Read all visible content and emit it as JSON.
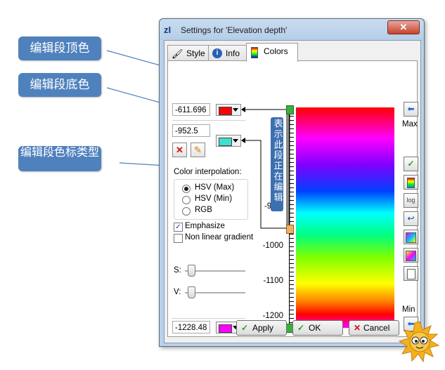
{
  "callouts": {
    "top_color": "编辑段顶色",
    "bottom_color": "编辑段底色",
    "color_type": "编辑段色标类型",
    "editing_note": "表示此段正在编辑"
  },
  "window": {
    "icon": "zI",
    "title": "Settings for 'Elevation depth'",
    "close_glyph": "✕"
  },
  "tabs": [
    {
      "label": "Style",
      "icon": "brush-icon"
    },
    {
      "label": "Info",
      "icon": "info-icon"
    },
    {
      "label": "Colors",
      "icon": "colors-icon",
      "active": true
    }
  ],
  "segment": {
    "top_value": "-611.696",
    "top_color": "#ff0000",
    "bottom_value": "-952.5",
    "bottom_color": "#40e0d0"
  },
  "interpolation": {
    "label": "Color interpolation:",
    "options": [
      {
        "label": "HSV (Max)",
        "selected": true
      },
      {
        "label": "HSV (Min)",
        "selected": false
      },
      {
        "label": "RGB",
        "selected": false
      }
    ]
  },
  "checkboxes": [
    {
      "label": "Emphasize",
      "checked": true
    },
    {
      "label": "Non linear gradient",
      "checked": false
    }
  ],
  "sliders": {
    "s_label": "S:",
    "s_value": 0,
    "v_label": "V:",
    "v_value": 0
  },
  "bottom": {
    "value": "-1228.48",
    "color": "#ff00ff"
  },
  "scale": {
    "ticks": [
      "-900",
      "-1000",
      "-1100",
      "-1200"
    ],
    "max_label": "Max",
    "min_label": "Min"
  },
  "right_buttons": [
    "arrow-left-icon",
    "check-icon",
    "palette-icon",
    "log-icon",
    "return-icon",
    "color-import-icon",
    "color-export-icon",
    "page-icon",
    "arrow-left-icon"
  ],
  "log_label": "log",
  "footer": {
    "apply": "Apply",
    "ok": "OK",
    "cancel": "Cancel"
  },
  "colors": {
    "accent": "#4f81bd",
    "editing_bar": "#3b6fb0"
  }
}
